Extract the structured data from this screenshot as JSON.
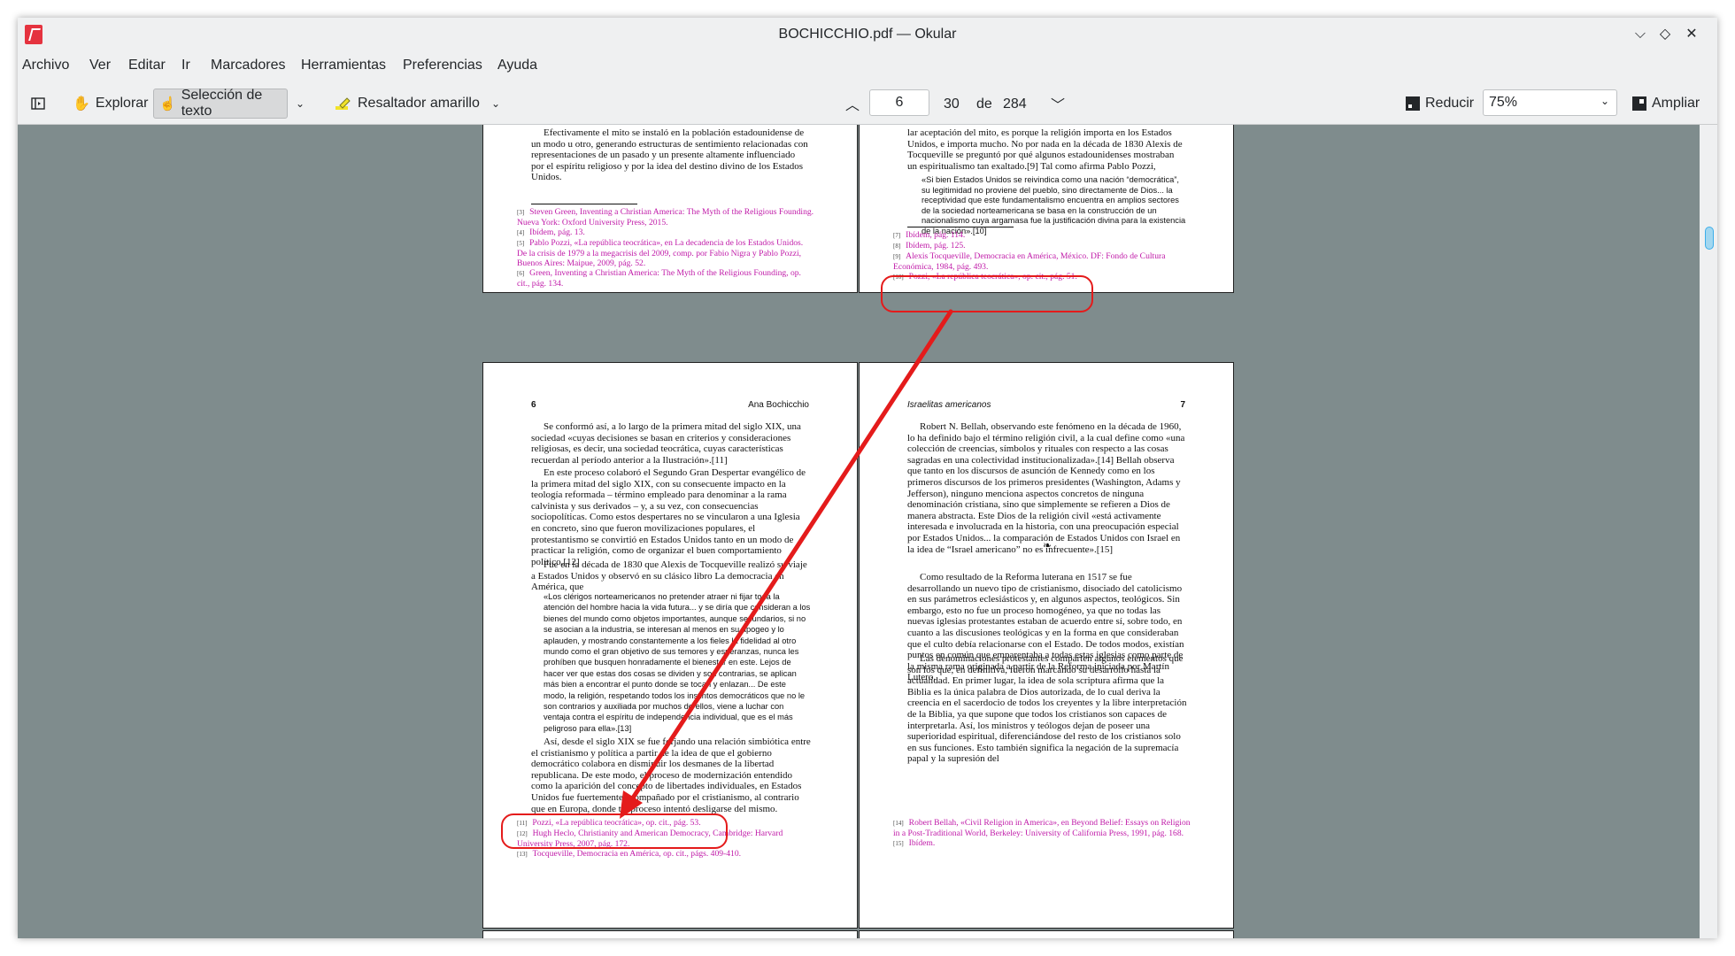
{
  "window": {
    "title": "BOCHICCHIO.pdf — Okular"
  },
  "menu": [
    "Archivo",
    "Ver",
    "Editar",
    "Ir",
    "Marcadores",
    "Herramientas",
    "Preferencias",
    "Ayuda"
  ],
  "toolbar": {
    "browse_label": "Explorar",
    "text_select_label": "Selección de texto",
    "highlighter_label": "Resaltador amarillo",
    "page_input": "6",
    "page_label": "30",
    "page_of": "de",
    "page_total": "284",
    "zoom_out_label": "Reducir",
    "zoom_value": "75%",
    "zoom_in_label": "Ampliar"
  },
  "pages": {
    "top_left": {
      "body": "Efectivamente el mito se instaló en la población estadounidense de un modo u otro, generando estructuras de sentimiento relacionadas con representaciones de un pasado y un presente altamente influenciado por el espíritu religioso y por la idea del destino divino de los Estados Unidos.",
      "footnotes": [
        {
          "n": "[3]",
          "t": "Steven Green, Inventing a Christian America: The Myth of the Religious Founding. Nueva York: Oxford University Press, 2015."
        },
        {
          "n": "[4]",
          "t": "Ibídem, pág. 13."
        },
        {
          "n": "[5]",
          "t": "Pablo Pozzi, «La república teocrática», en La decadencia de los Estados Unidos. De la crisis de 1979 a la megacrisis del 2009, comp. por Fabio Nigra y Pablo Pozzi, Buenos Aires: Maipue, 2009, pág. 52."
        },
        {
          "n": "[6]",
          "t": "Green, Inventing a Christian America: The Myth of the Religious Founding, op. cit., pág. 134."
        }
      ]
    },
    "top_right": {
      "body": "lar aceptación del mito, es porque la religión importa en los Estados Unidos, e importa mucho. No por nada en la década de 1830 Alexis de Tocqueville se preguntó por qué algunos estadounidenses mostraban un espiritualismo tan exaltado.[9] Tal como afirma Pablo Pozzi,",
      "quote": "«Si bien Estados Unidos se reivindica como una nación “democrática”, su legitimidad no proviene del pueblo, sino directamente de Dios... la receptividad que este fundamentalismo encuentra en amplios sectores de la sociedad norteamericana se basa en la construcción de un nacionalismo cuya argamasa fue la justificación divina para la existencia de la nación».[10]",
      "footnotes": [
        {
          "n": "[7]",
          "t": "Ibídem, pág. 114."
        },
        {
          "n": "[8]",
          "t": "Ibídem, pág. 125."
        },
        {
          "n": "[9]",
          "t": "Alexis Tocqueville, Democracia en América, México. DF: Fondo de Cultura Económica, 1984, pág. 493."
        },
        {
          "n": "[10]",
          "t": "Pozzi, «La república teocrática», op. cit., pág. 51."
        }
      ]
    },
    "mid_left": {
      "page_no": "6",
      "running_head": "Ana Bochicchio",
      "p1": "Se conformó así, a lo largo de la primera mitad del siglo XIX, una sociedad «cuyas decisiones se basan en criterios y consideraciones religiosas, es decir, una sociedad teocrática, cuyas características recuerdan al período anterior a la Ilustración».[11]",
      "p2": "En este proceso colaboró el Segundo Gran Despertar evangélico de la primera mitad del siglo XIX, con su consecuente impacto en la teología reformada – término empleado para denominar a la rama calvinista y sus derivados – y, a su vez, con consecuencias sociopolíticas. Como estos despertares no se vincularon a una Iglesia en concreto, sino que fueron movilizaciones populares, el protestantismo se convirtió en Estados Unidos tanto en un modo de practicar la religión, como de organizar el buen comportamiento político.[12]",
      "p3": "Fue en la década de 1830 que Alexis de Tocqueville realizó su viaje a Estados Unidos y observó en su clásico libro La democracia en América, que",
      "quote": "«Los clérigos norteamericanos no pretender atraer ni fijar toda la atención del hombre hacia la vida futura... y se diría que consideran a los bienes del mundo como objetos importantes, aunque secundarios, si no se asocian a la industria, se interesan al menos en su apogeo y lo aplauden, y mostrando constantemente a los fieles la fidelidad al otro mundo como el gran objetivo de sus temores y esperanzas, nunca les prohíben que busquen honradamente el bienestar en este. Lejos de hacer ver que estas dos cosas se dividen y son contrarias, se aplican más bien a encontrar el punto donde se tocan y enlazan... De este modo, la religión, respetando todos los instintos democráticos que no le son contrarios y auxiliada por muchos de ellos, viene a luchar con ventaja contra el espíritu de independencia individual, que es el más peligroso para ella».[13]",
      "p4": "Así, desde el siglo XIX se fue forjando una relación simbiótica entre el cristianismo y política a partir de la idea de que el gobierno democrático colabora en disminuir los desmanes de la libertad republicana. De este modo, el proceso de modernización entendido como la aparición del concepto de libertades individuales, en Estados Unidos fue fuertemente acompañado por el cristianismo, al contrario que en Europa, donde tal proceso intentó desligarse del mismo.",
      "footnotes": [
        {
          "n": "[11]",
          "t": "Pozzi, «La república teocrática», op. cit., pág. 53."
        },
        {
          "n": "[12]",
          "t": "Hugh Heclo, Christianity and American Democracy, Cambridge: Harvard University Press, 2007, pág. 172."
        },
        {
          "n": "[13]",
          "t": "Tocqueville, Democracia en América, op. cit., págs. 409-410."
        }
      ]
    },
    "mid_right": {
      "page_no": "7",
      "running_head": "Israelitas americanos",
      "p1": "Robert N. Bellah, observando este fenómeno en la década de 1960, lo ha definido bajo el término religión civil, a la cual define como «una colección de creencias, símbolos y rituales con respecto a las cosas sagradas en una colectividad institucionalizada».[14] Bellah observa que tanto en los discursos de asunción de Kennedy como en los primeros discursos de los primeros presidentes (Washington, Adams y Jefferson), ninguno menciona aspectos concretos de ninguna denominación cristiana, sino que simplemente se refieren a Dios de manera abstracta. Este Dios de la religión civil «está activamente interesada e involucrada en la historia, con una preocupación especial por Estados Unidos... la comparación de Estados Unidos con Israel en la idea de “Israel americano” no es infrecuente».[15]",
      "ornament": "❧",
      "p2": "Como resultado de la Reforma luterana en 1517 se fue desarrollando un nuevo tipo de cristianismo, disociado del catolicismo en sus parámetros eclesiásticos y, en algunos aspectos, teológicos. Sin embargo, esto no fue un proceso homogéneo, ya que no todas las nuevas iglesias protestantes estaban de acuerdo entre sí, sobre todo, en cuanto a las discusiones teológicas y en la forma en que consideraban que el culto debía relacionarse con el Estado. De todos modos, existían puntos en común que emparentaba a todas estas iglesias como parte de la misma rama originada a partir de la Reforma iniciada por Martín Lutero.",
      "p3": "Las denominaciones protestantes comparten algunos elementos que son los que, en definitiva, fueron marcando su desarrollo hasta la actualidad. En primer lugar, la idea de sola scriptura afirma que la Biblia es la única palabra de Dios autorizada, de lo cual deriva la creencia en el sacerdocio de todos los creyentes y la libre interpretación de la Biblia, ya que supone que todos los cristianos son capaces de interpretarla. Así, los ministros y teólogos dejan de poseer una superioridad espiritual, diferenciándose del resto de los cristianos solo en sus funciones. Esto también significa la negación de la supremacía papal y la supresión del",
      "footnotes": [
        {
          "n": "[14]",
          "t": "Robert Bellah, «Civil Religion in America», en Beyond Belief: Essays on Religion in a Post-Traditional World, Berkeley: University of California Press, 1991, pág. 168."
        },
        {
          "n": "[15]",
          "t": "Ibídem."
        }
      ]
    }
  }
}
